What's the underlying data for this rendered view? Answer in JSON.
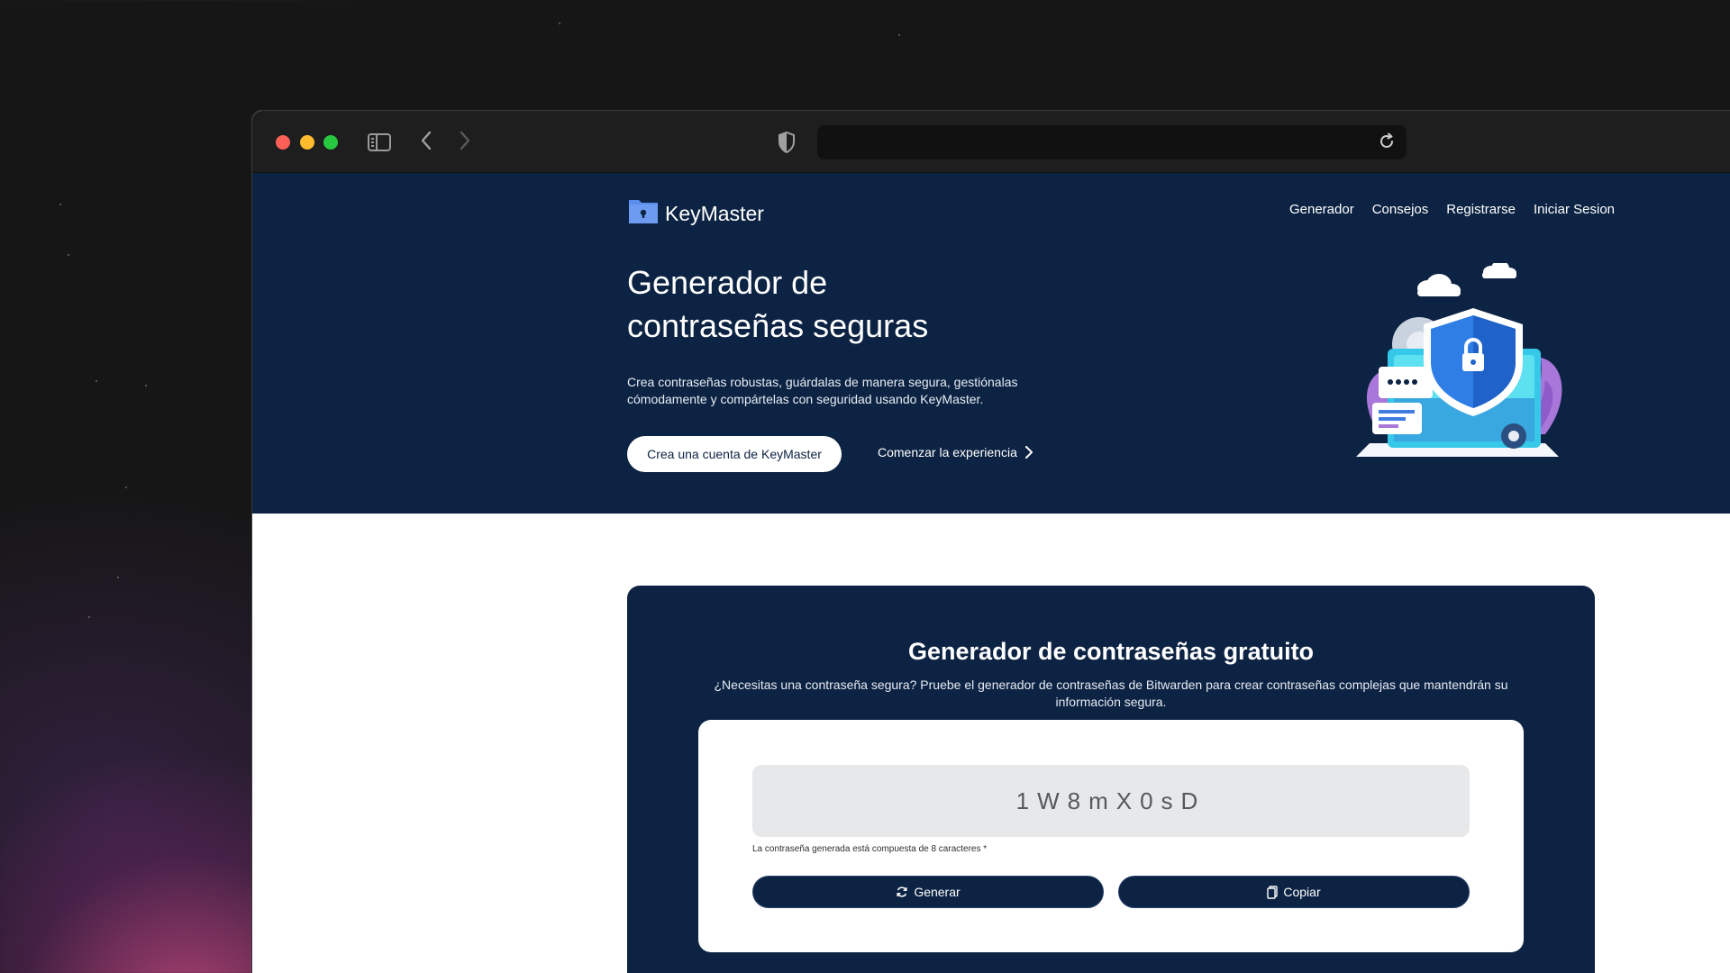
{
  "browser": {
    "url": ""
  },
  "site": {
    "brand": "KeyMaster",
    "nav": [
      "Generador",
      "Consejos",
      "Registrarse",
      "Iniciar Sesion"
    ]
  },
  "hero": {
    "title_line1": "Generador de",
    "title_line2": "contraseñas seguras",
    "description": "Crea contraseñas robustas, guárdalas de manera segura, gestiónalas cómodamente y compártelas con seguridad usando KeyMaster.",
    "primary_button": "Crea una cuenta de KeyMaster",
    "secondary_link": "Comenzar la experiencia"
  },
  "generator": {
    "title": "Generador de contraseñas gratuito",
    "subtitle": "¿Necesitas una contraseña segura? Pruebe el generador de contraseñas de Bitwarden para crear contraseñas complejas que mantendrán su información segura.",
    "password": "1W8mX0sD",
    "note": "La contraseña generada está compuesta de 8 caracteres *",
    "generate_label": "Generar",
    "copy_label": "Copiar"
  },
  "colors": {
    "navy": "#0d2343",
    "logo_blue": "#5b8def",
    "traffic_red": "#fe5f57",
    "traffic_yellow": "#febc2e",
    "traffic_green": "#28c840"
  },
  "icons": [
    "sidebar-icon",
    "back-chevron-icon",
    "forward-chevron-icon",
    "shield-icon",
    "reload-icon",
    "folder-lock-icon",
    "chevron-right-icon",
    "refresh-icon",
    "clipboard-icon",
    "security-illustration"
  ]
}
